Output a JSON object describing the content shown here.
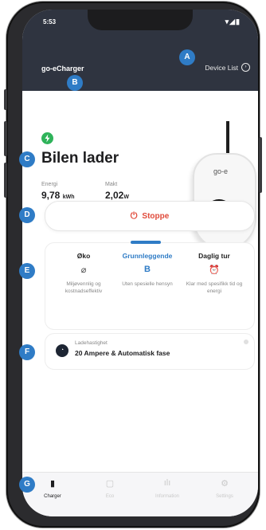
{
  "status_bar": {
    "time": "5:53",
    "icons": "▾◢▮"
  },
  "app": {
    "title": "go-eCharger",
    "device_list_label": "Device List"
  },
  "charger_status": {
    "headline": "Bilen lader"
  },
  "metrics": {
    "energy": {
      "label": "Energi",
      "value": "9,78",
      "unit": "kWh"
    },
    "power": {
      "label": "Makt",
      "value": "2,02",
      "unit": "W"
    }
  },
  "device_image": {
    "logo": "go-e"
  },
  "stop_button": {
    "label": "Stoppe",
    "icon": "power-icon"
  },
  "modes": [
    {
      "title": "Øko",
      "icon": "leaf-icon",
      "glyph": "⌀",
      "desc": "Miljøvennlig og kostnadseffektiv"
    },
    {
      "title": "Grunnleggende",
      "icon": "basic-mode-icon",
      "glyph": "B",
      "desc": "Uten spesielle hensyn"
    },
    {
      "title": "Daglig tur",
      "icon": "alarm-clock-icon",
      "glyph": "⏰",
      "desc": "Klar med spesifikk tid og energi"
    }
  ],
  "charging_speed": {
    "label": "Ladehastighet",
    "value": "20 Ampere & Automatisk fase"
  },
  "nav": [
    {
      "label": "Charger",
      "icon": "charger-icon",
      "glyph": "▮"
    },
    {
      "label": "Eco",
      "icon": "eco-icon",
      "glyph": "▢"
    },
    {
      "label": "Information",
      "icon": "bar-chart-icon",
      "glyph": "ılı"
    },
    {
      "label": "Settings",
      "icon": "gear-icon",
      "glyph": "⚙"
    }
  ],
  "markers": {
    "a": "A",
    "b": "B",
    "c": "C",
    "d": "D",
    "e": "E",
    "f": "F",
    "g": "G"
  },
  "colors": {
    "accent": "#2f7cc6",
    "stop": "#e04a3a",
    "charging": "#2fb35a",
    "header": "#2f3440"
  }
}
